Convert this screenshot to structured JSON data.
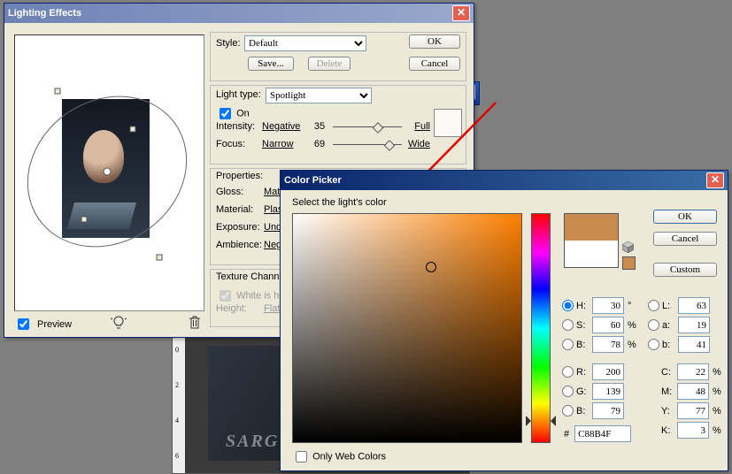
{
  "lighting": {
    "title": "Lighting Effects",
    "style_label": "Style:",
    "style_value": "Default",
    "save": "Save...",
    "delete": "Delete",
    "ok": "OK",
    "cancel": "Cancel",
    "light_type_label": "Light type:",
    "light_type_value": "Spotlight",
    "on_label": "On",
    "intensity_label": "Intensity:",
    "intensity_left": "Negative",
    "intensity_value": "35",
    "intensity_right": "Full",
    "focus_label": "Focus:",
    "focus_left": "Narrow",
    "focus_value": "69",
    "focus_right": "Wide",
    "properties_label": "Properties:",
    "gloss_label": "Gloss:",
    "gloss_left": "Matt",
    "material_label": "Material:",
    "material_left": "Plas",
    "exposure_label": "Exposure:",
    "exposure_left": "Und",
    "ambience_label": "Ambience:",
    "ambience_left": "Neg",
    "texture_label": "Texture Channe",
    "white_label": "White is hig",
    "height_label": "Height:",
    "height_left": "Flat",
    "preview_label": "Preview"
  },
  "picker": {
    "title": "Color Picker",
    "prompt": "Select the light's color",
    "ok": "OK",
    "cancel": "Cancel",
    "custom": "Custom",
    "only_web": "Only Web Colors",
    "H": {
      "label": "H:",
      "value": "30",
      "unit": "°"
    },
    "S": {
      "label": "S:",
      "value": "60",
      "unit": "%"
    },
    "Bh": {
      "label": "B:",
      "value": "78",
      "unit": "%"
    },
    "R": {
      "label": "R:",
      "value": "200"
    },
    "G": {
      "label": "G:",
      "value": "139"
    },
    "B": {
      "label": "B:",
      "value": "79"
    },
    "L": {
      "label": "L:",
      "value": "63"
    },
    "a": {
      "label": "a:",
      "value": "19"
    },
    "b": {
      "label": "b:",
      "value": "41"
    },
    "C": {
      "label": "C:",
      "value": "22",
      "unit": "%"
    },
    "M": {
      "label": "M:",
      "value": "48",
      "unit": "%"
    },
    "Y": {
      "label": "Y:",
      "value": "77",
      "unit": "%"
    },
    "K": {
      "label": "K:",
      "value": "3",
      "unit": "%"
    },
    "hex_label": "#",
    "hex_value": "C88B4F"
  },
  "watermark": "SARGONCO"
}
